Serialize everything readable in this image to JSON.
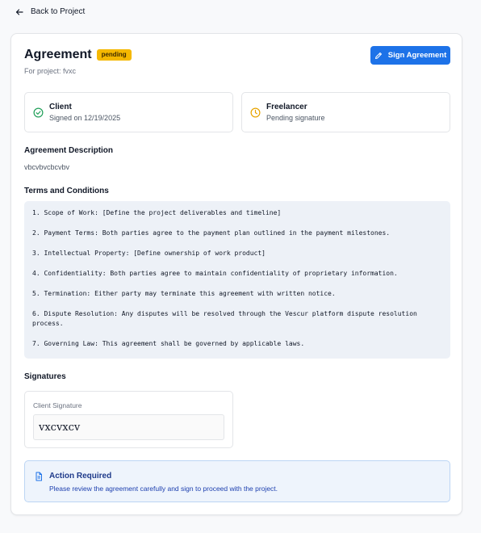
{
  "nav": {
    "back_label": "Back to Project"
  },
  "header": {
    "title": "Agreement",
    "status_badge": "pending",
    "subtitle": "For project: fvxc",
    "sign_button_label": "Sign Agreement"
  },
  "parties": [
    {
      "role": "Client",
      "status": "Signed on 12/19/2025",
      "icon": "check-circle-icon",
      "color": "#22a05a"
    },
    {
      "role": "Freelancer",
      "status": "Pending signature",
      "icon": "clock-icon",
      "color": "#e8a400"
    }
  ],
  "description": {
    "heading": "Agreement Description",
    "text": "vbcvbvcbcvbv"
  },
  "terms": {
    "heading": "Terms and Conditions",
    "items": [
      "1. Scope of Work: [Define the project deliverables and timeline]",
      "2. Payment Terms: Both parties agree to the payment plan outlined in the payment milestones.",
      "3. Intellectual Property: [Define ownership of work product]",
      "4. Confidentiality: Both parties agree to maintain confidentiality of proprietary information.",
      "5. Termination: Either party may terminate this agreement with written notice.",
      "6. Dispute Resolution: Any disputes will be resolved through the Vescur platform dispute resolution process.",
      "7. Governing Law: This agreement shall be governed by applicable laws."
    ]
  },
  "signatures": {
    "heading": "Signatures",
    "client_label": "Client Signature",
    "client_signature": "vxcvxcv"
  },
  "action": {
    "title": "Action Required",
    "text": "Please review the agreement carefully and sign to proceed with the project."
  },
  "colors": {
    "accent": "#1d72e8",
    "badge_pending": "#f5b800",
    "success": "#22a05a",
    "warning": "#e8a400"
  }
}
